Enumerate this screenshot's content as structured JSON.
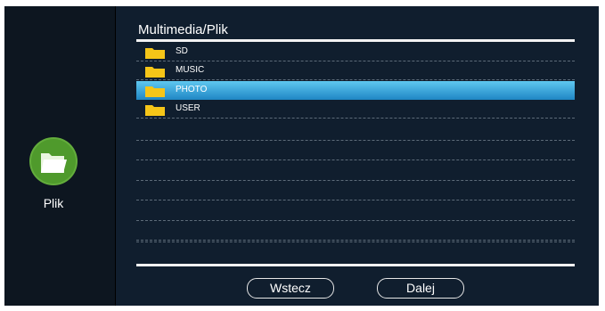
{
  "header": {
    "title": "Multimedia/Plik"
  },
  "sidebar": {
    "label": "Plik",
    "icon": "folder-icon"
  },
  "list": {
    "items": [
      {
        "label": "SD",
        "icon": "folder-icon",
        "selected": false
      },
      {
        "label": "MUSIC",
        "icon": "folder-icon",
        "selected": false
      },
      {
        "label": "PHOTO",
        "icon": "folder-icon",
        "selected": true
      },
      {
        "label": "USER",
        "icon": "folder-icon",
        "selected": false
      }
    ],
    "empty_rows": 7
  },
  "buttons": {
    "back_label": "Wstecz",
    "next_label": "Dalej"
  },
  "colors": {
    "selection_top": "#5fc8f0",
    "selection_bottom": "#1f86c4",
    "folder": "#f5c518",
    "sidebar_icon": "#63ad3c",
    "panel": "#101e2e"
  }
}
